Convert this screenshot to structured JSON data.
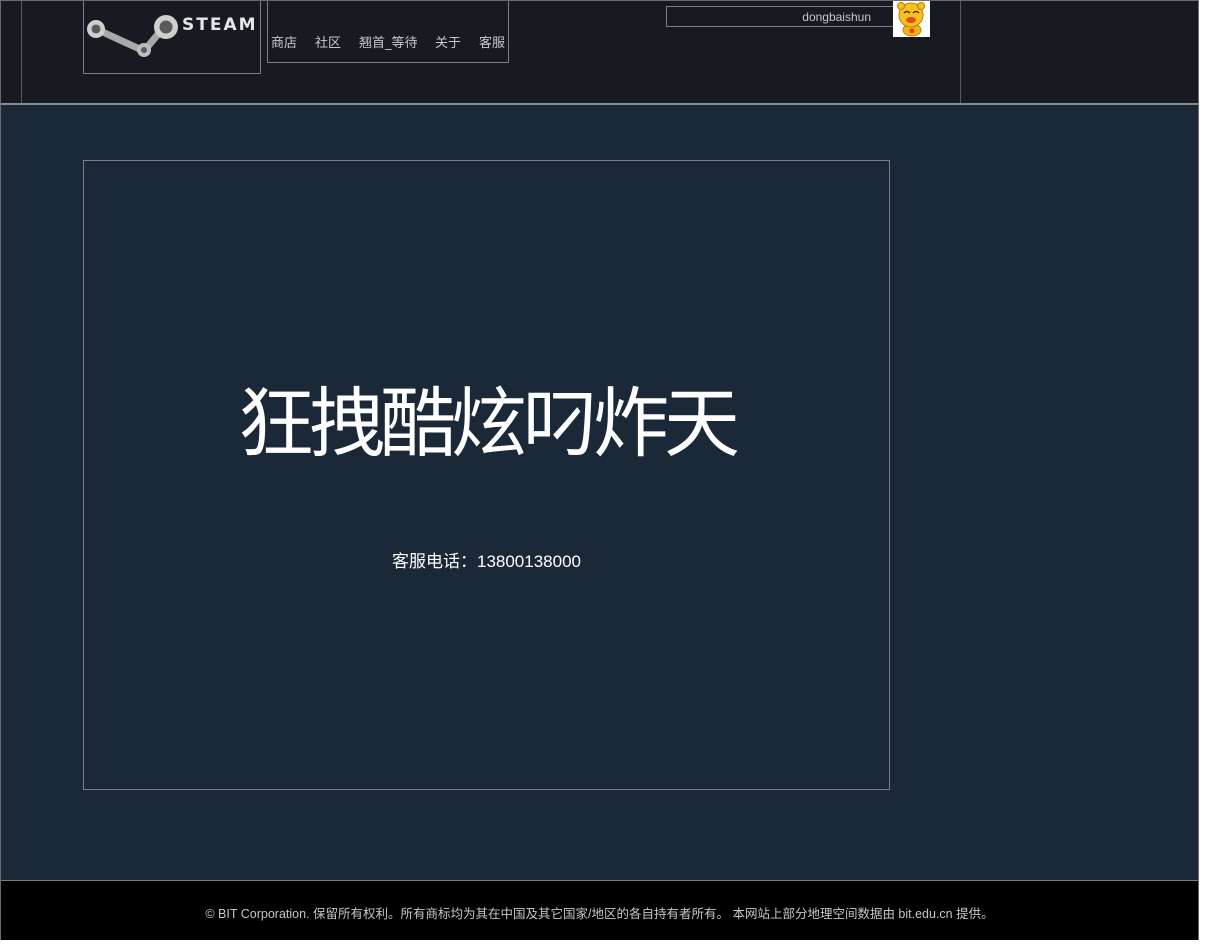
{
  "header": {
    "logo_text": "STEAM",
    "nav": [
      {
        "label": "商店"
      },
      {
        "label": "社区"
      },
      {
        "label": "翘首_等待"
      },
      {
        "label": "关于"
      },
      {
        "label": "客服"
      }
    ],
    "username": "dongbaishun"
  },
  "main": {
    "headline": "狂拽酷炫叼炸天",
    "support_phone": "客服电话：13800138000"
  },
  "footer": {
    "text": "© BIT Corporation. 保留所有权利。所有商标均为其在中国及其它国家/地区的各自持有者所有。 本网站上部分地理空间数据由 bit.edu.cn 提供。"
  },
  "colors": {
    "page_bg": "#1b2838",
    "header_bg": "#171a21",
    "footer_bg": "#000000",
    "border": "#7a7f87"
  }
}
